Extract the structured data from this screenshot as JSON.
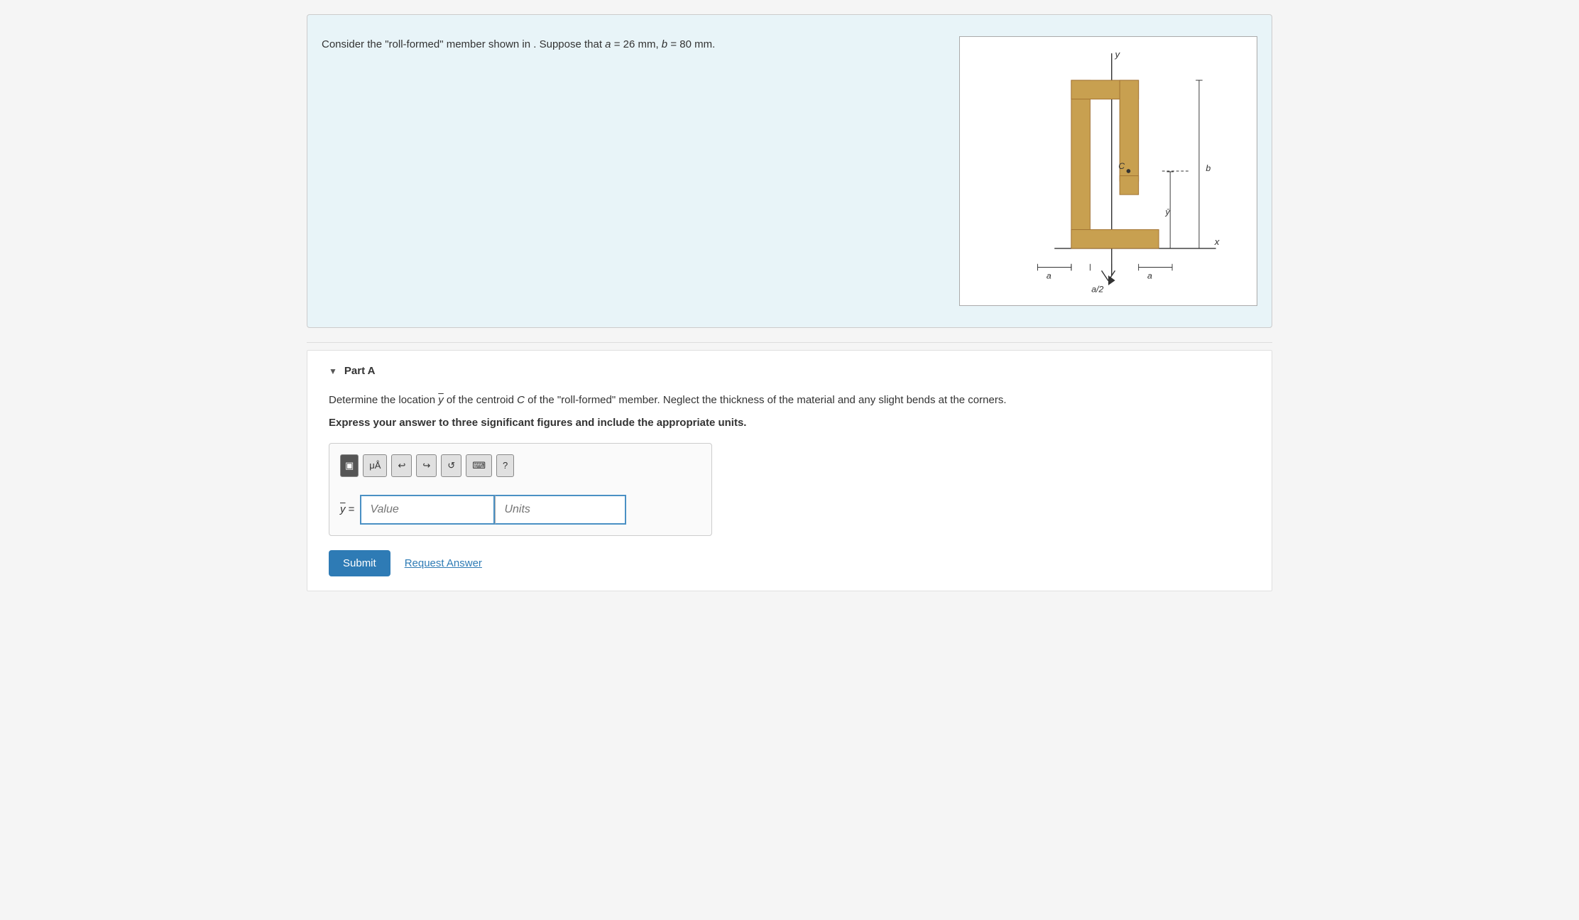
{
  "problem": {
    "statement": "Consider the \"roll-formed\" member shown in . Suppose that ",
    "params": "a = 26 mm, b = 80 mm.",
    "a_val": "26",
    "b_val": "80",
    "units": "mm"
  },
  "part_a": {
    "label": "Part A",
    "question": "Determine the location ȳ of the centroid C of the \"roll-formed\" member. Neglect the thickness of the material and any slight bends at the corners.",
    "instruction": "Express your answer to three significant figures and include the appropriate units.",
    "value_placeholder": "Value",
    "units_placeholder": "Units",
    "y_label": "ȳ =",
    "submit_label": "Submit",
    "request_label": "Request Answer"
  },
  "toolbar": {
    "undo_label": "↩",
    "redo_label": "↪",
    "reset_label": "↺",
    "keyboard_label": "⌨",
    "help_label": "?",
    "mu_label": "μÅ"
  },
  "icons": {
    "arrow_down": "▼",
    "grid_icon": "⊞"
  }
}
